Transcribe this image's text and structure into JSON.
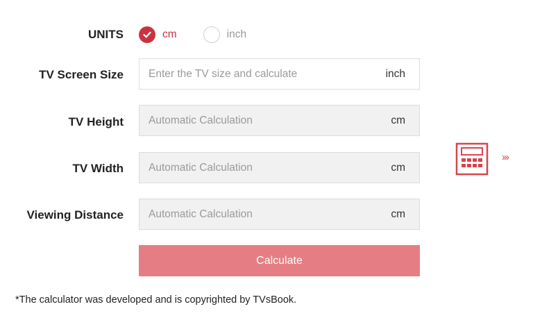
{
  "units": {
    "label": "UNITS",
    "options": [
      {
        "label": "cm",
        "checked": true
      },
      {
        "label": "inch",
        "checked": false
      }
    ]
  },
  "fields": [
    {
      "label": "TV Screen Size",
      "placeholder": "Enter the TV size and calculate",
      "unit": "inch",
      "editable": true
    },
    {
      "label": "TV Height",
      "placeholder": "Automatic Calculation",
      "unit": "cm",
      "editable": false
    },
    {
      "label": "TV Width",
      "placeholder": "Automatic Calculation",
      "unit": "cm",
      "editable": false
    },
    {
      "label": "Viewing Distance",
      "placeholder": "Automatic Calculation",
      "unit": "cm",
      "editable": false
    }
  ],
  "calculate_button": {
    "label": "Calculate"
  },
  "footnote": "*The calculator was developed and is copyrighted by TVsBook.",
  "side_icon": {
    "name": "calculator-icon",
    "arrows": "›››"
  },
  "colors": {
    "accent": "#c9333f",
    "button": "#e57e84",
    "field_disabled": "#f1f1f1",
    "border": "#dcdcdc"
  }
}
